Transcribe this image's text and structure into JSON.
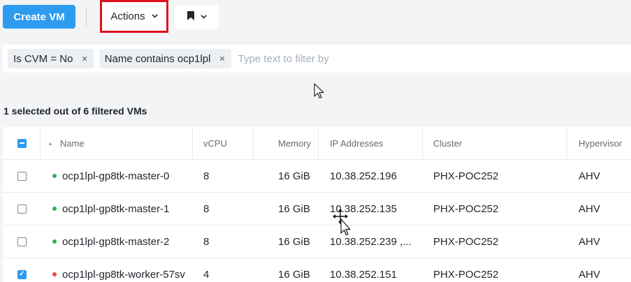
{
  "toolbar": {
    "create_label": "Create VM",
    "actions_label": "Actions",
    "chevron_icon": "chevron-down-icon",
    "bookmark_icon": "bookmark-icon"
  },
  "filters": {
    "chips": [
      "Is CVM = No",
      "Name contains ocp1lpl"
    ],
    "placeholder": "Type text to filter by"
  },
  "summary": "1 selected out of 6 filtered VMs",
  "table": {
    "columns": [
      "Name",
      "vCPU",
      "Memory",
      "IP Addresses",
      "Cluster",
      "Hypervisor"
    ],
    "rows": [
      {
        "name": "ocp1lpl-gp8tk-master-0",
        "vcpu": "8",
        "memory": "16 GiB",
        "ip": "10.38.252.196",
        "cluster": "PHX-POC252",
        "hypervisor": "AHV",
        "status": "on",
        "selected": false
      },
      {
        "name": "ocp1lpl-gp8tk-master-1",
        "vcpu": "8",
        "memory": "16 GiB",
        "ip": "10.38.252.135",
        "cluster": "PHX-POC252",
        "hypervisor": "AHV",
        "status": "on",
        "selected": false
      },
      {
        "name": "ocp1lpl-gp8tk-master-2",
        "vcpu": "8",
        "memory": "16 GiB",
        "ip": "10.38.252.239 ,...",
        "cluster": "PHX-POC252",
        "hypervisor": "AHV",
        "status": "on",
        "selected": false
      },
      {
        "name": "ocp1lpl-gp8tk-worker-57sv",
        "vcpu": "4",
        "memory": "16 GiB",
        "ip": "10.38.252.151",
        "cluster": "PHX-POC252",
        "hypervisor": "AHV",
        "status": "off",
        "selected": true
      }
    ]
  },
  "colors": {
    "accent": "#2d9bf0",
    "highlight_border": "#e0101a",
    "status_on": "#27b35a",
    "status_off": "#e8484f"
  }
}
